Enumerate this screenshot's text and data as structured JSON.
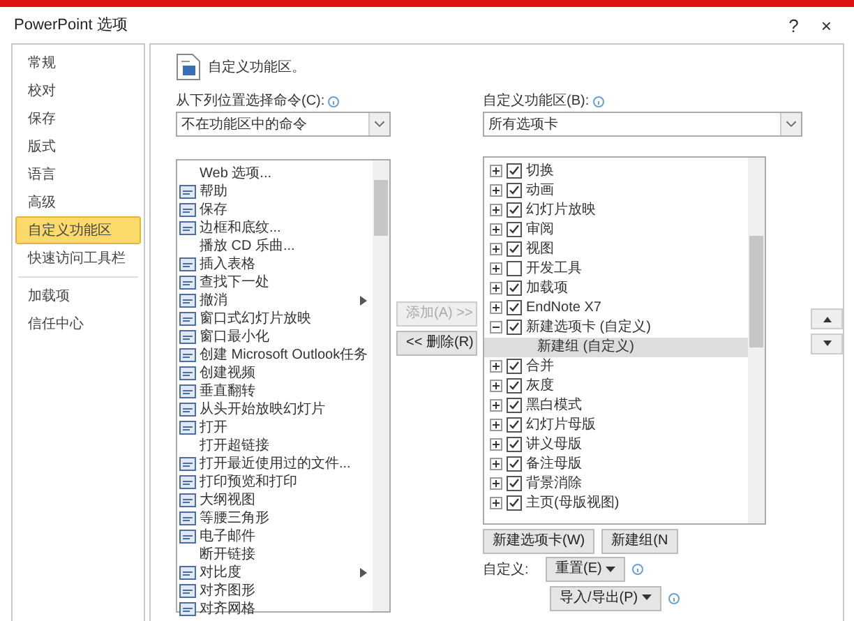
{
  "window": {
    "title": "PowerPoint 选项",
    "help": "?",
    "close": "×"
  },
  "sidebar": {
    "sections": [
      [
        {
          "label": "常规",
          "selected": false
        },
        {
          "label": "校对",
          "selected": false
        },
        {
          "label": "保存",
          "selected": false
        },
        {
          "label": "版式",
          "selected": false
        },
        {
          "label": "语言",
          "selected": false
        },
        {
          "label": "高级",
          "selected": false
        },
        {
          "label": "自定义功能区",
          "selected": true
        },
        {
          "label": "快速访问工具栏",
          "selected": false
        }
      ],
      [
        {
          "label": "加载项",
          "selected": false
        },
        {
          "label": "信任中心",
          "selected": false
        }
      ]
    ]
  },
  "header": "自定义功能区。",
  "left": {
    "label": "从下列位置选择命令(C):",
    "combo": "不在功能区中的命令",
    "commands": [
      {
        "label": "Web 选项...",
        "has_icon": false,
        "submenu": false
      },
      {
        "label": "帮助",
        "has_icon": true,
        "submenu": false
      },
      {
        "label": "保存",
        "has_icon": true,
        "submenu": false
      },
      {
        "label": "边框和底纹...",
        "has_icon": true,
        "submenu": false
      },
      {
        "label": "播放 CD 乐曲...",
        "has_icon": false,
        "submenu": false
      },
      {
        "label": "插入表格",
        "has_icon": true,
        "submenu": false
      },
      {
        "label": "查找下一处",
        "has_icon": true,
        "submenu": false
      },
      {
        "label": "撤消",
        "has_icon": true,
        "submenu": true
      },
      {
        "label": "窗口式幻灯片放映",
        "has_icon": true,
        "submenu": false
      },
      {
        "label": "窗口最小化",
        "has_icon": true,
        "submenu": false
      },
      {
        "label": "创建 Microsoft Outlook任务",
        "has_icon": true,
        "submenu": false
      },
      {
        "label": "创建视频",
        "has_icon": true,
        "submenu": false
      },
      {
        "label": "垂直翻转",
        "has_icon": true,
        "submenu": false
      },
      {
        "label": "从头开始放映幻灯片",
        "has_icon": true,
        "submenu": false
      },
      {
        "label": "打开",
        "has_icon": true,
        "submenu": false
      },
      {
        "label": "打开超链接",
        "has_icon": false,
        "submenu": false
      },
      {
        "label": "打开最近使用过的文件...",
        "has_icon": true,
        "submenu": false
      },
      {
        "label": "打印预览和打印",
        "has_icon": true,
        "submenu": false
      },
      {
        "label": "大纲视图",
        "has_icon": true,
        "submenu": false
      },
      {
        "label": "等腰三角形",
        "has_icon": true,
        "submenu": false
      },
      {
        "label": "电子邮件",
        "has_icon": true,
        "submenu": false
      },
      {
        "label": "断开链接",
        "has_icon": false,
        "submenu": false
      },
      {
        "label": "对比度",
        "has_icon": true,
        "submenu": true
      },
      {
        "label": "对齐图形",
        "has_icon": true,
        "submenu": false
      },
      {
        "label": "对齐网格",
        "has_icon": true,
        "submenu": false
      }
    ]
  },
  "add_button": {
    "label": "添加(A) >>",
    "disabled": true
  },
  "remove_button": {
    "label": "<< 删除(R)",
    "disabled": false
  },
  "right": {
    "label": "自定义功能区(B):",
    "combo": "所有选项卡",
    "tree": [
      {
        "kind": "tab",
        "label": "切换",
        "checked": true,
        "expanded": false,
        "selected": false
      },
      {
        "kind": "tab",
        "label": "动画",
        "checked": true,
        "expanded": false,
        "selected": false
      },
      {
        "kind": "tab",
        "label": "幻灯片放映",
        "checked": true,
        "expanded": false,
        "selected": false
      },
      {
        "kind": "tab",
        "label": "审阅",
        "checked": true,
        "expanded": false,
        "selected": false
      },
      {
        "kind": "tab",
        "label": "视图",
        "checked": true,
        "expanded": false,
        "selected": false
      },
      {
        "kind": "tab",
        "label": "开发工具",
        "checked": false,
        "expanded": false,
        "selected": false
      },
      {
        "kind": "tab",
        "label": "加载项",
        "checked": true,
        "expanded": false,
        "selected": false
      },
      {
        "kind": "tab",
        "label": "EndNote X7",
        "checked": true,
        "expanded": false,
        "selected": false
      },
      {
        "kind": "tab",
        "label": "新建选项卡 (自定义)",
        "checked": true,
        "expanded": true,
        "selected": false,
        "children": [
          {
            "kind": "group",
            "label": "新建组 (自定义)",
            "selected": true
          }
        ]
      },
      {
        "kind": "tab",
        "label": "合并",
        "checked": true,
        "expanded": false,
        "selected": false
      },
      {
        "kind": "tab",
        "label": "灰度",
        "checked": true,
        "expanded": false,
        "selected": false
      },
      {
        "kind": "tab",
        "label": "黑白模式",
        "checked": true,
        "expanded": false,
        "selected": false
      },
      {
        "kind": "tab",
        "label": "幻灯片母版",
        "checked": true,
        "expanded": false,
        "selected": false
      },
      {
        "kind": "tab",
        "label": "讲义母版",
        "checked": true,
        "expanded": false,
        "selected": false
      },
      {
        "kind": "tab",
        "label": "备注母版",
        "checked": true,
        "expanded": false,
        "selected": false
      },
      {
        "kind": "tab",
        "label": "背景消除",
        "checked": true,
        "expanded": false,
        "selected": false
      },
      {
        "kind": "tab",
        "label": "主页(母版视图)",
        "checked": true,
        "expanded": false,
        "selected": false
      }
    ],
    "new_tab_button": "新建选项卡(W)",
    "new_group_button": "新建组(N",
    "customize_label": "自定义:",
    "reset_button": "重置(E)",
    "import_export_button": "导入/导出(P)"
  }
}
